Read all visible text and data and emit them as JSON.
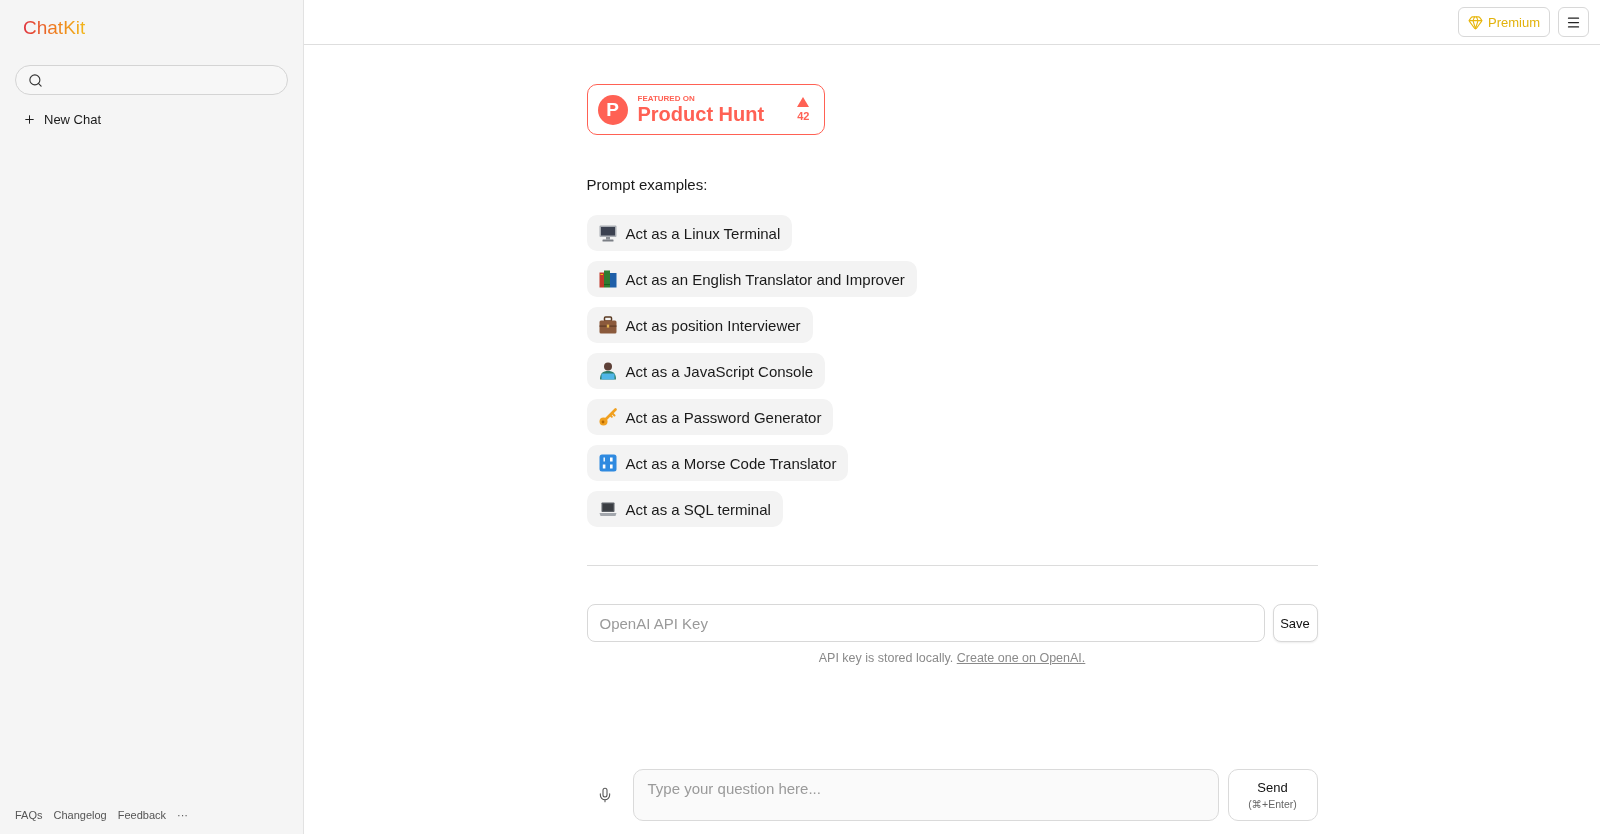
{
  "sidebar": {
    "logo": "ChatKit",
    "new_chat": "New Chat",
    "footer_links": [
      "FAQs",
      "Changelog",
      "Feedback"
    ],
    "more": "···"
  },
  "header": {
    "premium": "Premium"
  },
  "badge": {
    "logo_letter": "P",
    "caption": "FEATURED ON",
    "name": "Product Hunt",
    "votes": "42"
  },
  "prompts": {
    "title": "Prompt examples:",
    "items": [
      {
        "kind": "monitor",
        "label": "Act as a Linux Terminal"
      },
      {
        "kind": "books",
        "label": "Act as an English Translator and Improver"
      },
      {
        "kind": "briefcase",
        "label": "Act as position Interviewer"
      },
      {
        "kind": "coder",
        "label": "Act as a JavaScript Console"
      },
      {
        "kind": "key",
        "label": "Act as a Password Generator"
      },
      {
        "kind": "keypad",
        "label": "Act as a Morse Code Translator"
      },
      {
        "kind": "laptop",
        "label": "Act as a SQL terminal"
      }
    ]
  },
  "api_key": {
    "placeholder": "OpenAI API Key",
    "button": "Save",
    "note": "API key is stored locally.",
    "link": "Create one on OpenAI."
  },
  "composer": {
    "placeholder": "Type your question here...",
    "send": "Send",
    "shortcut": "(⌘+Enter)"
  }
}
